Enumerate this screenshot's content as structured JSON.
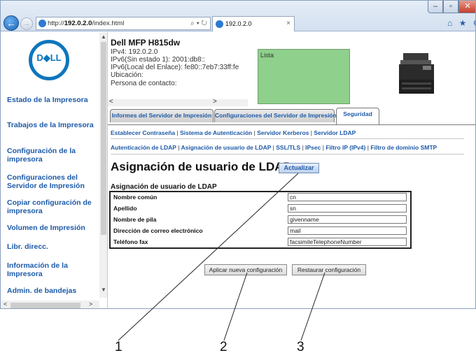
{
  "browser": {
    "address_prefix": "http://",
    "address_host": "192.0.2.0",
    "address_path": "/index.html",
    "address_tools": "⌕ ▾ ↻",
    "tab_title": "192.0.2.0",
    "tab_close": "×",
    "toolbar_icons": "⌂ ★ ⚙",
    "back_glyph": "←",
    "forward_glyph": "→",
    "window_min": "–",
    "window_max": "▫",
    "window_close": "✕"
  },
  "logo": {
    "text": "D◆LL"
  },
  "sidebar": {
    "items": [
      {
        "label": "Estado de la Impresora"
      },
      {
        "label": "Trabajos de la Impresora"
      },
      {
        "label": "Configuración de la impresora"
      },
      {
        "label": "Configuraciones del Servidor de Impresión"
      },
      {
        "label": "Copiar configuración de impresora"
      },
      {
        "label": "Volumen de Impresión"
      },
      {
        "label": "Libr. direcc."
      },
      {
        "label": "Información de la Impresora"
      },
      {
        "label": "Admin. de bandejas"
      }
    ],
    "scroll_up": "▲",
    "scroll_down": "▼",
    "scroll_left": "<",
    "scroll_right": ">"
  },
  "device": {
    "model": "Dell MFP H815dw",
    "ipv4": "IPv4: 192.0.2.0",
    "ipv6_stateless": "IPv6(Sin estado 1): 2001:db8::",
    "ipv6_link": "IPv6(Local del Enlace): fe80::7eb7:33ff:fe",
    "location": "Ubicación:",
    "contact": "Persona de contacto:",
    "status": "Lista",
    "scroll_left": "<",
    "scroll_right": ">"
  },
  "tabs": [
    {
      "label": "Informes del Servidor de Impresión"
    },
    {
      "label": "Configuraciones del Servidor de Impresión"
    },
    {
      "label": "Seguridad"
    }
  ],
  "sublinks_row1": [
    "Establecer Contraseña",
    "Sistema de Autenticación",
    "Servidor Kerberos",
    "Servidor LDAP"
  ],
  "sublinks_row2": [
    "Autenticación de LDAP",
    "Asignación de usuario de LDAP",
    "SSL/TLS",
    "IPsec",
    "Filtro IP (IPv4)",
    "Filtro de dominio SMTP"
  ],
  "separator": "|",
  "page": {
    "title": "Asignación de usuario de LDAP -",
    "refresh_label": "Actualizar",
    "section_title": "Asignación de usuario de LDAP"
  },
  "fields": [
    {
      "label": "Nombre común",
      "value": "cn"
    },
    {
      "label": "Apellido",
      "value": "sn"
    },
    {
      "label": "Nombre de pila",
      "value": "givenname"
    },
    {
      "label": "Dirección de correo electrónico",
      "value": "mail"
    },
    {
      "label": "Teléfono fax",
      "value": "facsimileTelephoneNumber"
    }
  ],
  "actions": {
    "apply_label": "Aplicar nueva configuración",
    "restore_label": "Restaurar configuración"
  },
  "callouts": [
    "1",
    "2",
    "3"
  ]
}
